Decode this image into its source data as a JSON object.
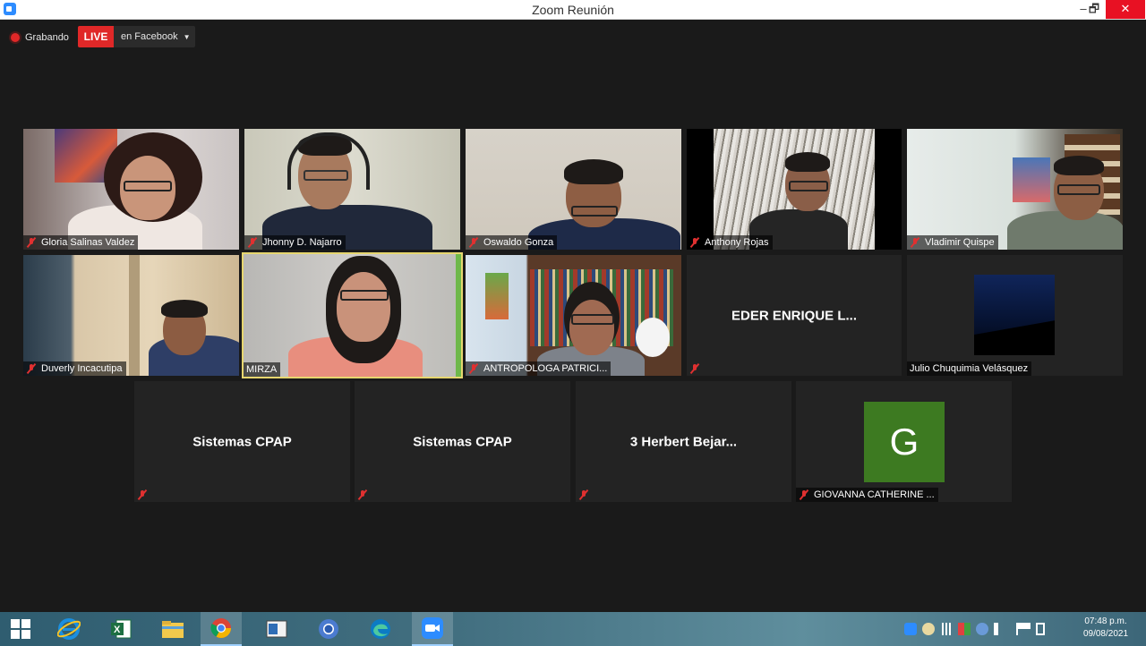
{
  "window": {
    "title": "Zoom Reunión",
    "min": "–",
    "max": "🗗",
    "close": "✕"
  },
  "recording": {
    "label": "Grabando"
  },
  "live": {
    "badge": "LIVE",
    "destination": "en Facebook",
    "caret": "▼"
  },
  "tiles": [
    {
      "name": "Gloria Salinas Valdez",
      "muted": true
    },
    {
      "name": "Jhonny D. Najarro",
      "muted": true
    },
    {
      "name": "Oswaldo Gonza",
      "muted": true
    },
    {
      "name": "Anthony Rojas",
      "muted": true
    },
    {
      "name": "Vladimir Quispe",
      "muted": true
    },
    {
      "name": "Duverly Incacutipa",
      "muted": true
    },
    {
      "name": "MIRZA",
      "muted": false,
      "active_speaker": true
    },
    {
      "name": "ANTROPOLOGA PATRICI...",
      "muted": true
    },
    {
      "name": "EDER ENRIQUE L...",
      "muted": true,
      "video": false
    },
    {
      "name": "Julio Chuquimia Velásquez",
      "muted": false
    },
    {
      "name": "Sistemas CPAP",
      "muted": true,
      "video": false
    },
    {
      "name": "Sistemas CPAP",
      "muted": true,
      "video": false
    },
    {
      "name": "3 Herbert Bejar...",
      "muted": true,
      "video": false
    },
    {
      "name": "GIOVANNA CATHERINE ...",
      "muted": true,
      "avatar_letter": "G",
      "avatar_color": "#3d7a21"
    }
  ],
  "taskbar": {
    "apps": [
      "windows-start",
      "internet-explorer",
      "excel",
      "file-explorer",
      "chrome",
      "app-window",
      "chrome-alt",
      "edge",
      "zoom"
    ],
    "clock_time": "07:48 p.m.",
    "clock_date": "09/08/2021"
  }
}
